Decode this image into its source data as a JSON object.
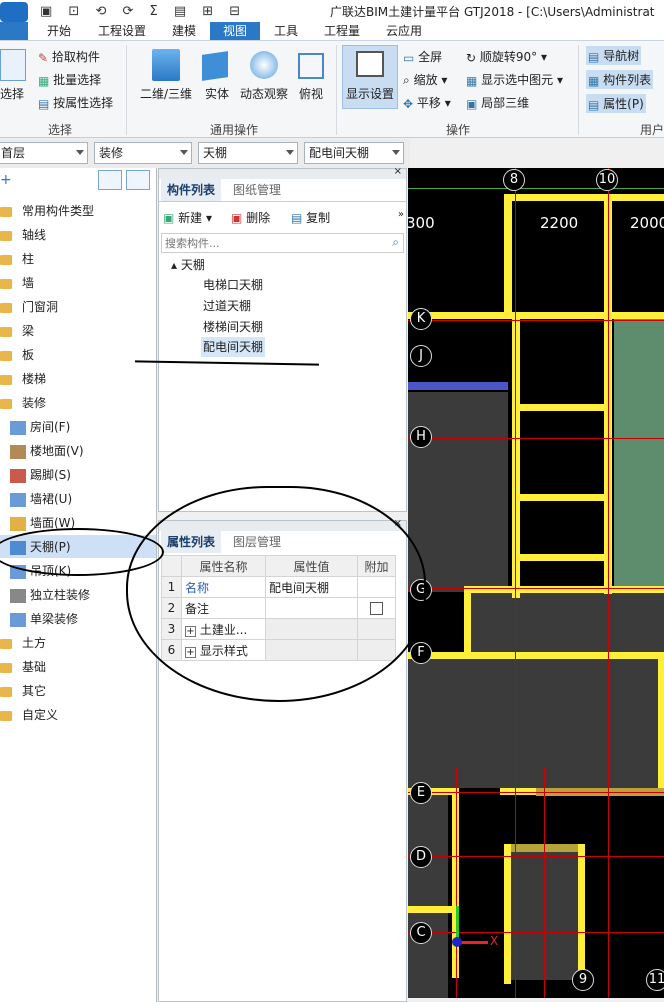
{
  "titlebar": {
    "title": "广联达BIM土建计量平台 GTJ2018 - [C:\\Users\\Administrat"
  },
  "tabs": [
    "开始",
    "工程设置",
    "建模",
    "视图",
    "工具",
    "工程量",
    "云应用"
  ],
  "ribbon": {
    "select": {
      "label": "选择",
      "pick": "拾取构件",
      "batch": "批量选择",
      "byattr": "按属性选择",
      "group": "选择"
    },
    "general": {
      "view2d3d": "二维/三维",
      "solid": "实体",
      "orbit": "动态观察",
      "top": "俯视",
      "group": "通用操作"
    },
    "ops": {
      "display": "显示设置",
      "fullscreen": "全屏",
      "zoom": "缩放",
      "pan": "平移",
      "rotate": "顺旋转90°",
      "showsel": "显示选中图元",
      "local3d": "局部三维",
      "group": "操作"
    },
    "user": {
      "navtree": "导航树",
      "complist": "构件列表",
      "props": "属性(P)",
      "group": "用户"
    }
  },
  "filters": {
    "floor": "首层",
    "category": "装修",
    "type": "天棚",
    "component": "配电间天棚"
  },
  "navtree": {
    "items": [
      "常用构件类型",
      "轴线",
      "柱",
      "墙",
      "门窗洞",
      "梁",
      "板",
      "楼梯",
      "装修"
    ],
    "sub": [
      "房间(F)",
      "楼地面(V)",
      "踢脚(S)",
      "墙裙(U)",
      "墙面(W)",
      "天棚(P)",
      "吊顶(K)",
      "独立柱装修",
      "单梁装修"
    ],
    "tail": [
      "土方",
      "基础",
      "其它",
      "自定义"
    ]
  },
  "complist": {
    "tab1": "构件列表",
    "tab2": "图纸管理",
    "new": "新建",
    "delete": "删除",
    "copy": "复制",
    "search_placeholder": "搜索构件...",
    "root": "天棚",
    "children": [
      "电梯口天棚",
      "过道天棚",
      "楼梯间天棚",
      "配电间天棚"
    ]
  },
  "props": {
    "tab1": "属性列表",
    "tab2": "图层管理",
    "headers": [
      "属性名称",
      "属性值",
      "附加"
    ],
    "rows": [
      {
        "no": "1",
        "name": "名称",
        "value": "配电间天棚"
      },
      {
        "no": "2",
        "name": "备注",
        "value": ""
      },
      {
        "no": "3",
        "name": "土建业...",
        "value": ""
      },
      {
        "no": "6",
        "name": "显示样式",
        "value": ""
      }
    ]
  },
  "canvas": {
    "axes_top": [
      "8",
      "10"
    ],
    "dims": [
      "300",
      "2200",
      "2000"
    ],
    "axes_left": [
      "K",
      "J",
      "H",
      "G",
      "F",
      "E",
      "D",
      "C"
    ],
    "axes_bottom": [
      "9",
      "11"
    ],
    "axis_x": "X"
  },
  "colors": {
    "accent": "#2b79c6",
    "wall": "#ffef3a",
    "room": "#3b3b3b",
    "green": "#5d8d6d"
  }
}
